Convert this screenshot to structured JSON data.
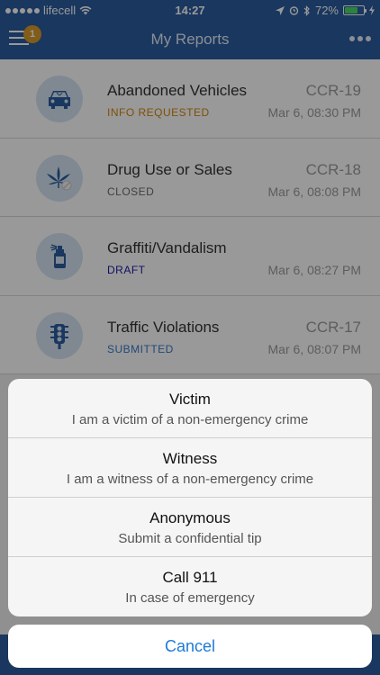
{
  "status_bar": {
    "carrier": "lifecell",
    "time": "14:27",
    "battery": "72%",
    "battery_level": 0.72
  },
  "nav": {
    "title": "My Reports",
    "badge_count": "1"
  },
  "reports": [
    {
      "title": "Abandoned Vehicles",
      "status": "INFO REQUESTED",
      "status_class": "st-info",
      "code": "CCR-19",
      "date": "Mar 6, 08:30 PM",
      "icon": "car-icon"
    },
    {
      "title": "Drug Use or Sales",
      "status": "CLOSED",
      "status_class": "st-closed",
      "code": "CCR-18",
      "date": "Mar 6, 08:08 PM",
      "icon": "cannabis-leaf-icon"
    },
    {
      "title": "Graffiti/Vandalism",
      "status": "DRAFT",
      "status_class": "st-draft",
      "code": "",
      "date": "Mar 6, 08:27 PM",
      "icon": "spray-can-icon"
    },
    {
      "title": "Traffic Violations",
      "status": "SUBMITTED",
      "status_class": "st-submitted",
      "code": "CCR-17",
      "date": "Mar 6, 08:07 PM",
      "icon": "traffic-light-icon"
    }
  ],
  "action_sheet": {
    "options": [
      {
        "title": "Victim",
        "subtitle": "I am a victim of a non-emergency crime"
      },
      {
        "title": "Witness",
        "subtitle": "I am a witness of a non-emergency crime"
      },
      {
        "title": "Anonymous",
        "subtitle": "Submit a confidential tip"
      },
      {
        "title": "Call 911",
        "subtitle": "In case of emergency"
      }
    ],
    "cancel_label": "Cancel"
  },
  "colors": {
    "nav_bar": "#2b5d9e",
    "accent": "#1e7ad6",
    "info_requested": "#d4860b",
    "draft": "#1a1aa6",
    "submitted": "#3b78c7"
  }
}
